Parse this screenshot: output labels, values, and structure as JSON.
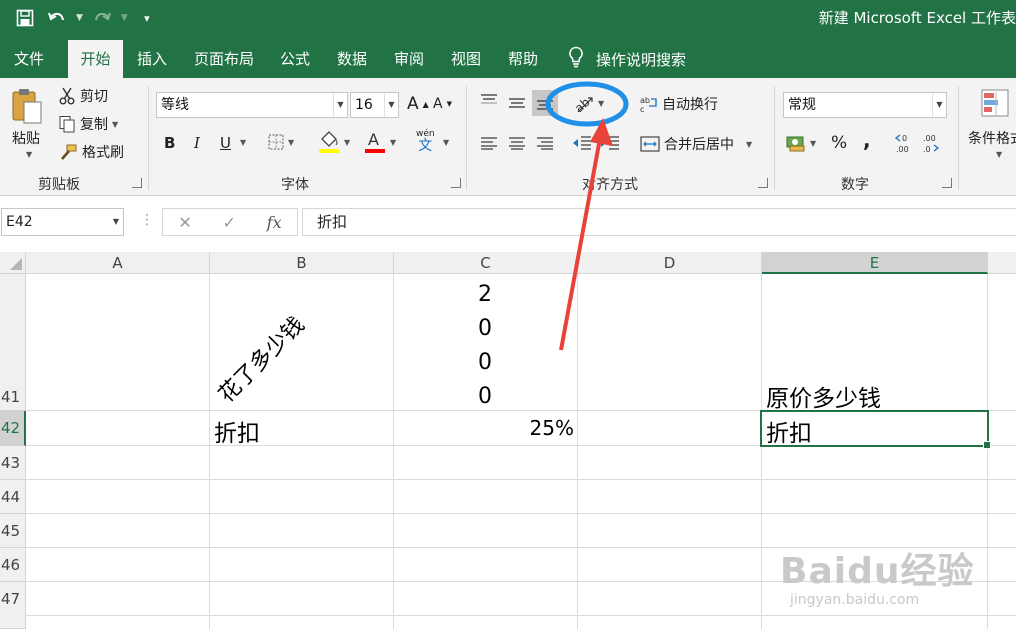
{
  "window": {
    "title": "新建 Microsoft Excel 工作表"
  },
  "qat": {
    "save_icon": "save-icon",
    "undo_icon": "undo-icon",
    "redo_icon": "redo-icon",
    "customize_icon": "customize-qat-icon"
  },
  "tabs": [
    {
      "label": "文件"
    },
    {
      "label": "开始"
    },
    {
      "label": "插入"
    },
    {
      "label": "页面布局"
    },
    {
      "label": "公式"
    },
    {
      "label": "数据"
    },
    {
      "label": "审阅"
    },
    {
      "label": "视图"
    },
    {
      "label": "帮助"
    }
  ],
  "active_tab": "开始",
  "tell_me": {
    "label": "操作说明搜索",
    "icon": "lightbulb-icon"
  },
  "ribbon": {
    "clipboard": {
      "paste": "粘贴",
      "cut": "剪切",
      "copy": "复制",
      "format_painter": "格式刷",
      "label": "剪贴板"
    },
    "font": {
      "name": "等线",
      "size": "16",
      "bold": "B",
      "italic": "I",
      "underline": "U",
      "label": "字体",
      "fill_color": "#ffff00",
      "font_color": "#ff0000",
      "phonetic": "wén",
      "phonetic_char": "文"
    },
    "alignment": {
      "wrap_text": "自动换行",
      "merge_center": "合并后居中",
      "label": "对齐方式"
    },
    "number": {
      "format": "常规",
      "percent": "%",
      "comma": ",",
      "label": "数字"
    },
    "styles": {
      "conditional_formatting": "条件格式"
    }
  },
  "formula_bar": {
    "name_box": "E42",
    "cancel": "✕",
    "enter": "✓",
    "fx": "fx",
    "content": "折扣"
  },
  "columns": [
    {
      "label": "A"
    },
    {
      "label": "B"
    },
    {
      "label": "C"
    },
    {
      "label": "D"
    },
    {
      "label": "E"
    }
  ],
  "rows": [
    {
      "label": "41"
    },
    {
      "label": "42"
    },
    {
      "label": "43"
    },
    {
      "label": "44"
    },
    {
      "label": "45"
    },
    {
      "label": "46"
    },
    {
      "label": "47"
    }
  ],
  "cells": {
    "B41": "花了多少钱",
    "C41": [
      "2",
      "0",
      "0",
      "0"
    ],
    "E41": "原价多少钱",
    "B42": "折扣",
    "C42": "25%",
    "E42": "折扣"
  },
  "selected_cell": "E42",
  "annotation": {
    "highlight": "orientation-button",
    "circle_color": "#1e90e8",
    "arrow_color": "#e8423a"
  },
  "watermark": {
    "brand": "Baidu经验",
    "url": "jingyan.baidu.com"
  },
  "colors": {
    "excel_green": "#217346",
    "ribbon_bg": "#f3f3f3"
  }
}
